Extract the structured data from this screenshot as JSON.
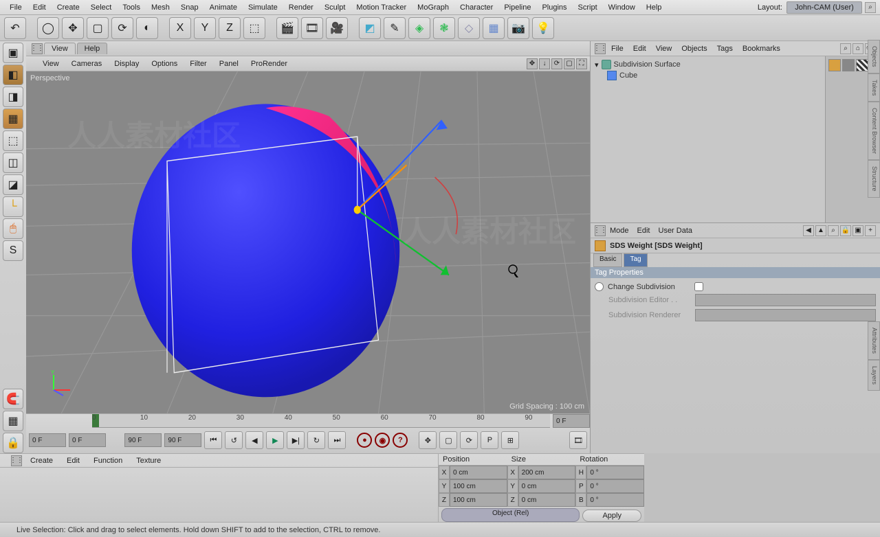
{
  "menubar": [
    "File",
    "Edit",
    "Create",
    "Select",
    "Tools",
    "Mesh",
    "Snap",
    "Animate",
    "Simulate",
    "Render",
    "Sculpt",
    "Motion Tracker",
    "MoGraph",
    "Character",
    "Pipeline",
    "Plugins",
    "Script",
    "Window",
    "Help"
  ],
  "layout": {
    "label": "Layout:",
    "value": "John-CAM (User)"
  },
  "view_tabs": {
    "view": "View",
    "help": "Help"
  },
  "view_sub": [
    "View",
    "Cameras",
    "Display",
    "Options",
    "Filter",
    "Panel",
    "ProRender"
  ],
  "viewport": {
    "label": "Perspective",
    "grid_spacing": "Grid Spacing : 100 cm"
  },
  "timeline": {
    "ticks": [
      "0",
      "10",
      "20",
      "30",
      "40",
      "50",
      "60",
      "70",
      "80",
      "90"
    ],
    "start_field": "0 F",
    "left_range": "0 F",
    "right_range": "90 F",
    "end_field": "90 F",
    "current": "0 F"
  },
  "material_menu": [
    "Create",
    "Edit",
    "Function",
    "Texture"
  ],
  "coord": {
    "headers": [
      "Position",
      "Size",
      "Rotation"
    ],
    "rows": [
      {
        "axis": "X",
        "pos": "0 cm",
        "size": "200 cm",
        "rotL": "H",
        "rot": "0 °"
      },
      {
        "axis": "Y",
        "pos": "100 cm",
        "size": "0 cm",
        "rotL": "P",
        "rot": "0 °"
      },
      {
        "axis": "Z",
        "pos": "100 cm",
        "size": "0 cm",
        "rotL": "B",
        "rot": "0 °"
      }
    ],
    "mode": "Object (Rel)",
    "apply": "Apply"
  },
  "statusbar": "Live Selection: Click and drag to select elements. Hold down SHIFT to add to the selection, CTRL to remove.",
  "obj_menu": [
    "File",
    "Edit",
    "View",
    "Objects",
    "Tags",
    "Bookmarks"
  ],
  "objects": {
    "root": "Subdivision Surface",
    "child": "Cube"
  },
  "attr_menu": [
    "Mode",
    "Edit",
    "User Data"
  ],
  "attr_title": "SDS Weight [SDS Weight]",
  "attr_tabs": {
    "basic": "Basic",
    "tag": "Tag"
  },
  "attr_section": "Tag Properties",
  "attr_props": {
    "change_sub": "Change Subdivision",
    "sub_editor": "Subdivision Editor . .",
    "sub_renderer": "Subdivision Renderer"
  },
  "side_tabs": [
    "Objects",
    "Takes",
    "Content Browser",
    "Structure",
    "Attributes",
    "Layers"
  ]
}
